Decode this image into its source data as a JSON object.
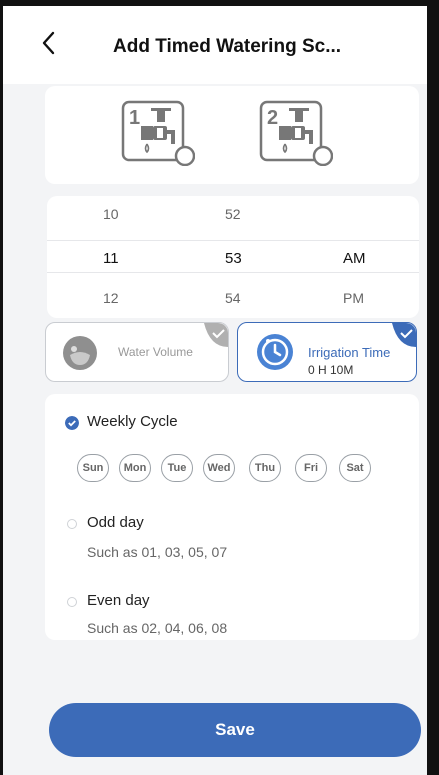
{
  "header": {
    "back_icon": "chevron-left-icon",
    "title": "Add Timed Watering Sc..."
  },
  "valves": [
    {
      "number": "1",
      "icon": "faucet-icon"
    },
    {
      "number": "2",
      "icon": "faucet-icon"
    }
  ],
  "time_picker": {
    "hours": [
      "10",
      "11",
      "12"
    ],
    "minutes": [
      "52",
      "53",
      "54"
    ],
    "periods": [
      "",
      "AM",
      "PM"
    ],
    "selected": {
      "hour": "11",
      "minute": "53",
      "period": "AM"
    }
  },
  "modes": {
    "water_volume": {
      "label": "Water Volume",
      "icon": "water-drop-icon",
      "selected": false
    },
    "irrigation_time": {
      "label": "Irrigation Time",
      "value": "0 H 10M",
      "icon": "clock-icon",
      "selected": true
    }
  },
  "schedule": {
    "weekly": {
      "label": "Weekly Cycle",
      "selected": true,
      "days": [
        "Sun",
        "Mon",
        "Tue",
        "Wed",
        "Thu",
        "Fri",
        "Sat"
      ]
    },
    "odd": {
      "label": "Odd day",
      "hint": "Such as 01, 03, 05, 07",
      "selected": false
    },
    "even": {
      "label": "Even day",
      "hint": "Such as 02, 04, 06, 08",
      "selected": false
    }
  },
  "actions": {
    "save_label": "Save"
  },
  "colors": {
    "accent": "#3c6bb8",
    "accent_light": "#4a83d4",
    "background": "#f3f4f6",
    "card": "#ffffff"
  }
}
